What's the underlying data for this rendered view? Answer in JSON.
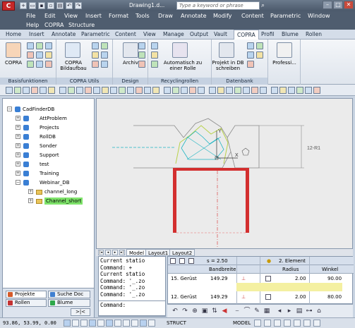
{
  "title_bar": {
    "app_logo": "C",
    "document_title": "Drawing1.d...",
    "search_placeholder": "Type a keyword or phrase",
    "window_controls": [
      "–",
      "□",
      "✕"
    ]
  },
  "menubar": {
    "items": [
      "File",
      "Edit",
      "View",
      "Insert",
      "Format",
      "Tools",
      "Draw",
      "Annotate",
      "Modify",
      "Content",
      "Parametric",
      "Window",
      "Help",
      "COPRA",
      "Structure"
    ]
  },
  "ribbon_tabs": [
    "Home",
    "Insert",
    "Annotate",
    "Parametric",
    "Content",
    "View",
    "Manage",
    "Output",
    "Vault",
    "COPRA",
    "Profil",
    "Blume",
    "Rollen"
  ],
  "active_ribbon_tab": "COPRA",
  "ribbon": {
    "copra_button": "COPRA",
    "bildaufbau_label": "COPRA Bildaufbau",
    "archiv_label": "Archiv",
    "automatisch_label": "Automatisch zu einer Rolle",
    "projekt_label": "Projekt in DB schreiben",
    "professional_label": "Professi...",
    "panels": [
      "Basisfunktionen",
      "COPRA Utils",
      "Design",
      "Recyclingrollen",
      "Datenbank"
    ]
  },
  "tree": {
    "root": "CadFinderDB",
    "items": [
      "AttProblem",
      "Projects",
      "RollDB",
      "Sonder",
      "Support",
      "test",
      "Training",
      "Webinar_DB"
    ],
    "children": [
      "channel_long",
      "Channel_short"
    ],
    "selected": "Channel_short"
  },
  "left_tabs": {
    "projekte": "Projekte",
    "suche_doc": "Suche Doc",
    "rollen": "Rollen",
    "blume": "Blume",
    "nav_label": ">|<"
  },
  "drawing": {
    "dimension_label": "12-R1",
    "tabs": [
      "Model",
      "Layout1",
      "Layout2"
    ],
    "active_tab": "Model",
    "axis_x_label": "X",
    "axis_y_label": "Y"
  },
  "command_history": [
    "Current statio",
    "Command: +",
    "Current statio",
    "Command: '_.zo",
    "Command: '_.zo",
    "Command: '_.zo",
    "Command: '_.zo"
  ],
  "command_prompt": "Command:",
  "table": {
    "s_label": "s = 2.50",
    "element_label": "2. Element",
    "col_bandbreite": "Bandbreite",
    "col_radius": "Radius",
    "col_winkel": "Winkel",
    "rows": [
      {
        "name": "15. Gerüst",
        "bandbreite": "149.29",
        "radius": "2.00",
        "winkel": "90.00"
      },
      {
        "name": "12. Gerüst",
        "bandbreite": "149.29",
        "radius": "2.00",
        "winkel": "80.00"
      }
    ]
  },
  "statusbar": {
    "coords": "93.86, 53.99, 0.00",
    "struct": "STRUCT",
    "model": "MODEL"
  },
  "colors": {
    "accent_red": "#d32f2f",
    "cyan_line": "#1fb5c3",
    "selection_green": "#7ee36a",
    "title_bg": "#4f5d6f"
  }
}
